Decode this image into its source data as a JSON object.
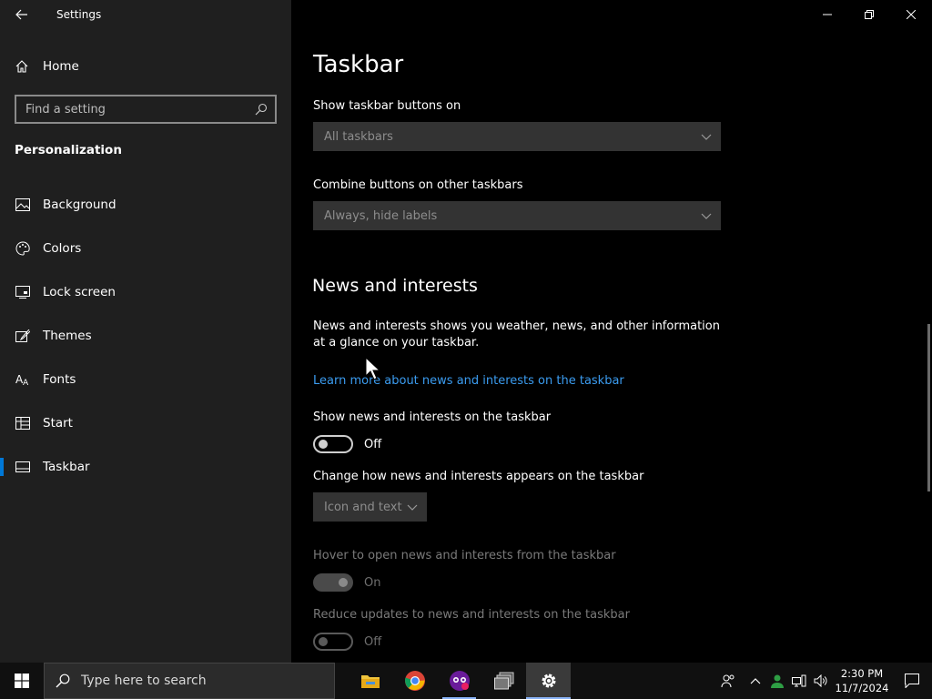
{
  "window": {
    "title": "Settings"
  },
  "sidebar": {
    "home_label": "Home",
    "search_placeholder": "Find a setting",
    "section": "Personalization",
    "items": [
      {
        "label": "Background",
        "icon": "image-icon"
      },
      {
        "label": "Colors",
        "icon": "palette-icon"
      },
      {
        "label": "Lock screen",
        "icon": "lock-screen-icon"
      },
      {
        "label": "Themes",
        "icon": "themes-icon"
      },
      {
        "label": "Fonts",
        "icon": "fonts-icon"
      },
      {
        "label": "Start",
        "icon": "start-icon"
      },
      {
        "label": "Taskbar",
        "icon": "taskbar-icon",
        "active": true
      }
    ]
  },
  "main": {
    "title": "Taskbar",
    "show_buttons_label": "Show taskbar buttons on",
    "show_buttons_value": "All taskbars",
    "combine_label": "Combine buttons on other taskbars",
    "combine_value": "Always, hide labels",
    "news_heading": "News and interests",
    "news_desc": "News and interests shows you weather, news, and other information at a glance on your taskbar.",
    "news_link": "Learn more about news and interests on the taskbar",
    "show_news_label": "Show news and interests on the taskbar",
    "show_news_state": "Off",
    "change_label": "Change how news and interests appears on the taskbar",
    "change_value": "Icon and text",
    "hover_label": "Hover to open news and interests from the taskbar",
    "hover_state": "On",
    "reduce_label": "Reduce updates to news and interests on the taskbar",
    "reduce_state": "Off"
  },
  "taskbar": {
    "search_placeholder": "Type here to search",
    "apps": [
      "file-explorer-icon",
      "chrome-icon",
      "vpn-app-icon",
      "task-manager-icon",
      "settings-icon"
    ],
    "time": "2:30 PM",
    "date": "11/7/2024"
  },
  "colors": {
    "accent": "#0078d7",
    "link": "#3b9cf0"
  }
}
